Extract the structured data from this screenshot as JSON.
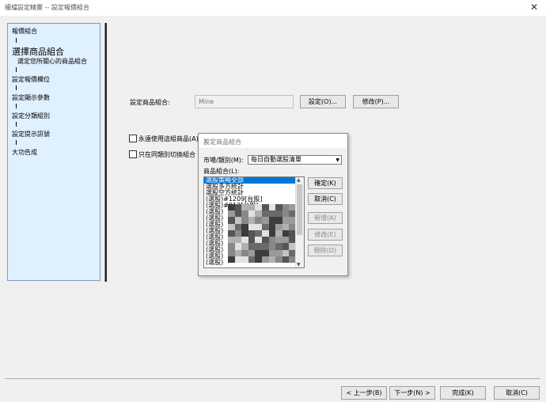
{
  "window": {
    "title": "權檔設定精靈 -- 設定報價組合",
    "close": "✕"
  },
  "steps": [
    {
      "label": "報價組合"
    },
    {
      "label": "選擇商品組合"
    },
    {
      "label": "選定您所關心的商品組合"
    },
    {
      "label": "設定報價欄位"
    },
    {
      "label": "設定顯示參數"
    },
    {
      "label": "設定分類組別"
    },
    {
      "label": "設定提示訊號"
    },
    {
      "label": "大功告成"
    }
  ],
  "main": {
    "product_group_label": "設定商品組合:",
    "product_group_value": "Mine",
    "set_button": "設定(O)...",
    "modify_button": "修改(P)...",
    "always_use_label": "永遠使用這組商品(A)",
    "only_switch_label": "只在同類別切換組合"
  },
  "dialog": {
    "title": "設定商品組合",
    "close": "✕",
    "market_label": "市場/類別(M):",
    "market_value": "每日自動選股清單",
    "group_label": "商品組合(L):",
    "items": [
      "選股策略全部",
      "選股多方統計",
      "選股空方統計",
      "(選股)#1209[台股]",
      "(選股)#912[台股]",
      "(選股)",
      "(選股)",
      "(選股)",
      "(選股)",
      "(選股)",
      "(選股)",
      "(選股)",
      "(選股)",
      "(選股)"
    ],
    "ok": "確定(K)",
    "cancel": "取消(C)",
    "add": "新增(A)",
    "edit": "修改(E)",
    "delete": "刪除(D)"
  },
  "footer": {
    "prev": "< 上一步(B)",
    "next": "下一步(N) >",
    "finish": "完成(K)",
    "cancel": "取消(C)"
  }
}
